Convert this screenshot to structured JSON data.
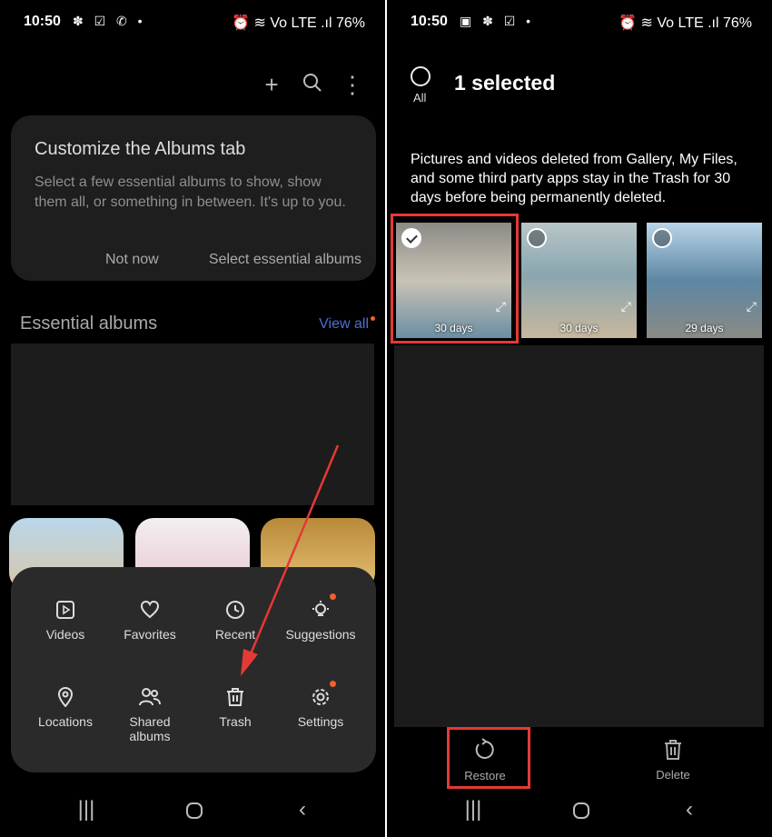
{
  "left": {
    "status": {
      "time": "10:50",
      "icons": "✽ ☑ ✆ •",
      "right": "⏰ ≋ Vo LTE .ıl 76%"
    },
    "card": {
      "title": "Customize the Albums tab",
      "body": "Select a few essential albums to show, show them all, or something in between. It's up to you.",
      "not_now": "Not now",
      "select": "Select essential albums"
    },
    "essential": {
      "title": "Essential albums",
      "view_all": "View all"
    },
    "menu": [
      {
        "label": "Videos",
        "icon": "video-icon"
      },
      {
        "label": "Favorites",
        "icon": "heart-icon"
      },
      {
        "label": "Recent",
        "icon": "clock-icon"
      },
      {
        "label": "Suggestions",
        "icon": "lightbulb-icon"
      },
      {
        "label": "Locations",
        "icon": "location-pin-icon"
      },
      {
        "label": "Shared albums",
        "icon": "people-icon"
      },
      {
        "label": "Trash",
        "icon": "trash-icon"
      },
      {
        "label": "Settings",
        "icon": "gear-icon"
      }
    ],
    "accent": "#f0612c"
  },
  "right": {
    "status": {
      "time": "10:50",
      "icons": "▣ ✽ ☑ •",
      "right": "⏰ ≋ Vo LTE .ıl 76%"
    },
    "all_label": "All",
    "selected_title": "1 selected",
    "info": "Pictures and videos deleted from Gallery, My Files, and some third party apps stay in the Trash for 30 days before being permanently deleted.",
    "photos": [
      {
        "days": "30 days",
        "selected": true
      },
      {
        "days": "30 days",
        "selected": false
      },
      {
        "days": "29 days",
        "selected": false
      }
    ],
    "restore": "Restore",
    "delete": "Delete"
  },
  "highlight_color": "#e53935"
}
